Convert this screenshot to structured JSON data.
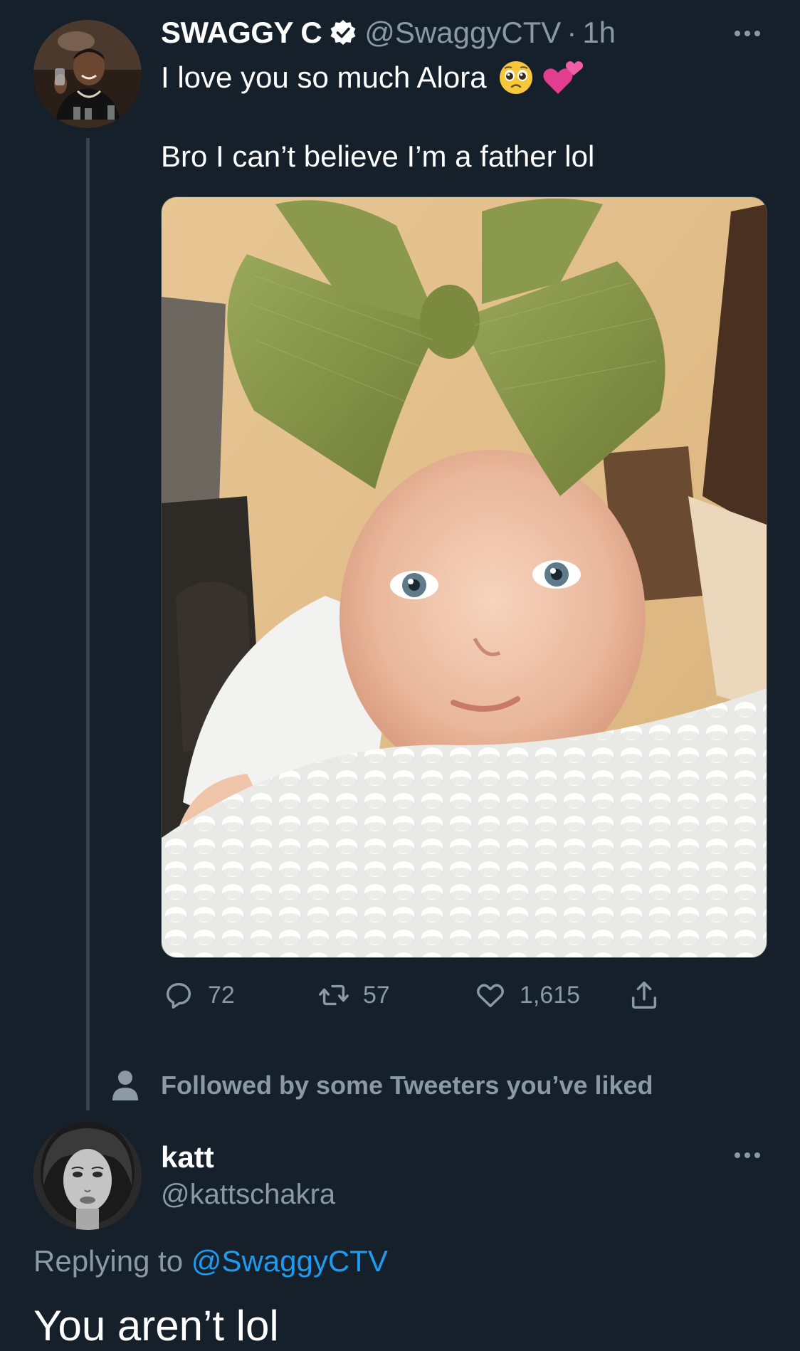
{
  "tweet": {
    "display_name": "SWAGGY C",
    "handle": "@SwaggyCTV",
    "separator": "·",
    "time": "1h",
    "text_line_1": "I love you so much Alora",
    "text_line_2": "Bro I can’t believe I’m a father lol",
    "emoji_1": "pleading-face-emoji",
    "emoji_2": "two-hearts-emoji",
    "media_description_icon": "photo",
    "actions": {
      "reply_count": "72",
      "retweet_count": "57",
      "like_count": "1,615"
    },
    "social_context": "Followed by some Tweeters you’ve liked"
  },
  "reply": {
    "display_name": "katt",
    "handle": "@kattschakra",
    "replying_prefix": "Replying to ",
    "replying_mention": "@SwaggyCTV",
    "text": "You aren’t lol"
  },
  "colors": {
    "background": "#15202b",
    "secondary_text": "#8b98a5",
    "link": "#1d9bf0",
    "verified_badge": "#ffffff",
    "heart_pink": "#e0245e"
  }
}
